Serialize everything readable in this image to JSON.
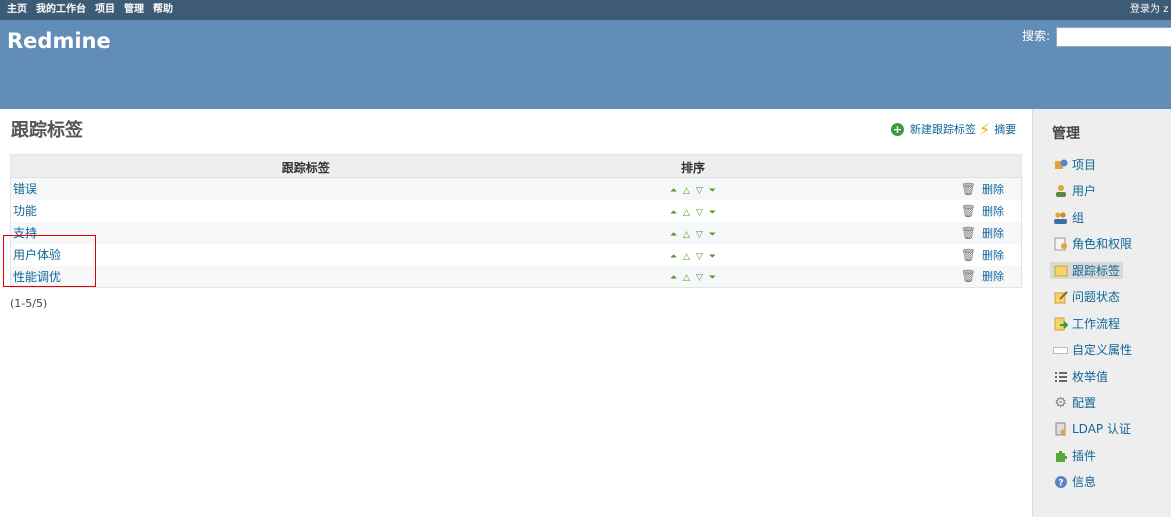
{
  "top_menu": {
    "items": [
      "主页",
      "我的工作台",
      "项目",
      "管理",
      "帮助"
    ],
    "logged_as": "登录为 z"
  },
  "header": {
    "title": "Redmine",
    "search_label": "搜索:",
    "search_value": ""
  },
  "page": {
    "title": "跟踪标签",
    "new_label": "新建跟踪标签",
    "summary_label": "摘要"
  },
  "table": {
    "columns": [
      "跟踪标签",
      "排序"
    ],
    "rows": [
      {
        "name": "错误",
        "delete": "删除"
      },
      {
        "name": "功能",
        "delete": "删除"
      },
      {
        "name": "支持",
        "delete": "删除"
      },
      {
        "name": "用户体验",
        "delete": "删除"
      },
      {
        "name": "性能调优",
        "delete": "删除"
      }
    ]
  },
  "pagination": "(1-5/5)",
  "sidebar": {
    "title": "管理",
    "items": [
      {
        "label": "项目",
        "icon": "projects-icon"
      },
      {
        "label": "用户",
        "icon": "user-icon"
      },
      {
        "label": "组",
        "icon": "group-icon"
      },
      {
        "label": "角色和权限",
        "icon": "roles-icon"
      },
      {
        "label": "跟踪标签",
        "icon": "tracker-icon",
        "selected": true
      },
      {
        "label": "问题状态",
        "icon": "issue-status-icon"
      },
      {
        "label": "工作流程",
        "icon": "workflow-icon"
      },
      {
        "label": "自定义属性",
        "icon": "custom-field-icon"
      },
      {
        "label": "枚举值",
        "icon": "list-icon"
      },
      {
        "label": "配置",
        "icon": "gear-icon"
      },
      {
        "label": "LDAP 认证",
        "icon": "server-icon"
      },
      {
        "label": "插件",
        "icon": "plugin-icon"
      },
      {
        "label": "信息",
        "icon": "help-icon"
      }
    ]
  },
  "colors": {
    "top_menu_bg": "#3e5b76",
    "header_bg": "#628db6",
    "link": "#116699",
    "sidebar_bg": "#eeeeee",
    "highlight_border": "#e00000"
  }
}
